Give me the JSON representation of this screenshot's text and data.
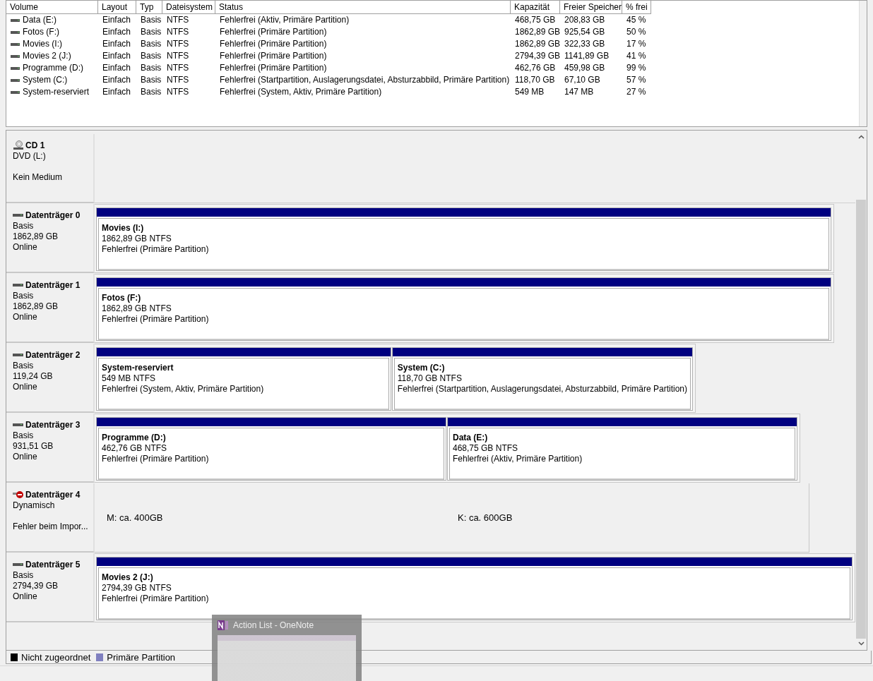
{
  "volume_table": {
    "columns": [
      "Volume",
      "Layout",
      "Typ",
      "Dateisystem",
      "Status",
      "Kapazität",
      "Freier Speicher",
      "% frei"
    ],
    "rows": [
      {
        "volume": "Data (E:)",
        "layout": "Einfach",
        "type": "Basis",
        "filesystem": "NTFS",
        "status": "Fehlerfrei (Aktiv, Primäre Partition)",
        "capacity": "468,75 GB",
        "free": "208,83 GB",
        "percent_free": "45 %"
      },
      {
        "volume": "Fotos (F:)",
        "layout": "Einfach",
        "type": "Basis",
        "filesystem": "NTFS",
        "status": "Fehlerfrei (Primäre Partition)",
        "capacity": "1862,89 GB",
        "free": "925,54 GB",
        "percent_free": "50 %"
      },
      {
        "volume": "Movies (I:)",
        "layout": "Einfach",
        "type": "Basis",
        "filesystem": "NTFS",
        "status": "Fehlerfrei (Primäre Partition)",
        "capacity": "1862,89 GB",
        "free": "322,33 GB",
        "percent_free": "17 %"
      },
      {
        "volume": "Movies 2 (J:)",
        "layout": "Einfach",
        "type": "Basis",
        "filesystem": "NTFS",
        "status": "Fehlerfrei (Primäre Partition)",
        "capacity": "2794,39 GB",
        "free": "1141,89 GB",
        "percent_free": "41 %"
      },
      {
        "volume": "Programme (D:)",
        "layout": "Einfach",
        "type": "Basis",
        "filesystem": "NTFS",
        "status": "Fehlerfrei (Primäre Partition)",
        "capacity": "462,76 GB",
        "free": "459,98 GB",
        "percent_free": "99 %"
      },
      {
        "volume": "System (C:)",
        "layout": "Einfach",
        "type": "Basis",
        "filesystem": "NTFS",
        "status": "Fehlerfrei (Startpartition, Auslagerungsdatei, Absturzabbild, Primäre Partition)",
        "capacity": "118,70 GB",
        "free": "67,10 GB",
        "percent_free": "57 %"
      },
      {
        "volume": "System-reserviert",
        "layout": "Einfach",
        "type": "Basis",
        "filesystem": "NTFS",
        "status": "Fehlerfrei (System, Aktiv, Primäre Partition)",
        "capacity": "549 MB",
        "free": "147 MB",
        "percent_free": "27 %"
      }
    ]
  },
  "disks": [
    {
      "kind": "optical",
      "title": "CD 1",
      "subtitle": "DVD (L:)",
      "status": "Kein Medium"
    },
    {
      "kind": "basic",
      "title": "Datenträger 0",
      "subtitle": "Basis",
      "size": "1862,89 GB",
      "status": "Online",
      "partitions": [
        {
          "name": "Movies  (I:)",
          "size": "1862,89 GB NTFS",
          "status": "Fehlerfrei (Primäre Partition)"
        }
      ]
    },
    {
      "kind": "basic",
      "title": "Datenträger 1",
      "subtitle": "Basis",
      "size": "1862,89 GB",
      "status": "Online",
      "partitions": [
        {
          "name": "Fotos  (F:)",
          "size": "1862,89 GB NTFS",
          "status": "Fehlerfrei (Primäre Partition)"
        }
      ]
    },
    {
      "kind": "basic",
      "title": "Datenträger 2",
      "subtitle": "Basis",
      "size": "119,24 GB",
      "status": "Online",
      "partitions": [
        {
          "name": "System-reserviert",
          "size": "549 MB NTFS",
          "status": "Fehlerfrei (System, Aktiv, Primäre Partition)"
        },
        {
          "name": "System  (C:)",
          "size": "118,70 GB NTFS",
          "status": "Fehlerfrei (Startpartition, Auslagerungsdatei, Absturzabbild, Primäre Partition)"
        }
      ]
    },
    {
      "kind": "basic",
      "title": "Datenträger 3",
      "subtitle": "Basis",
      "size": "931,51 GB",
      "status": "Online",
      "partitions": [
        {
          "name": "Programme  (D:)",
          "size": "462,76 GB NTFS",
          "status": "Fehlerfrei (Primäre Partition)"
        },
        {
          "name": "Data  (E:)",
          "size": "468,75 GB NTFS",
          "status": "Fehlerfrei (Aktiv, Primäre Partition)"
        }
      ]
    },
    {
      "kind": "error",
      "title": "Datenträger 4",
      "subtitle": "Dynamisch",
      "status": "Fehler beim Impor...",
      "notes": [
        "M: ca. 400GB",
        "K: ca. 600GB"
      ]
    },
    {
      "kind": "basic",
      "title": "Datenträger 5",
      "subtitle": "Basis",
      "size": "2794,39 GB",
      "status": "Online",
      "partitions": [
        {
          "name": "Movies 2  (J:)",
          "size": "2794,39 GB NTFS",
          "status": "Fehlerfrei (Primäre Partition)"
        }
      ]
    }
  ],
  "legend": [
    {
      "label": "Nicht zugeordnet",
      "color": "#000000"
    },
    {
      "label": "Primäre Partition",
      "color": "#8080c0"
    }
  ],
  "taskbar_preview": {
    "title": "Action List - OneNote"
  }
}
